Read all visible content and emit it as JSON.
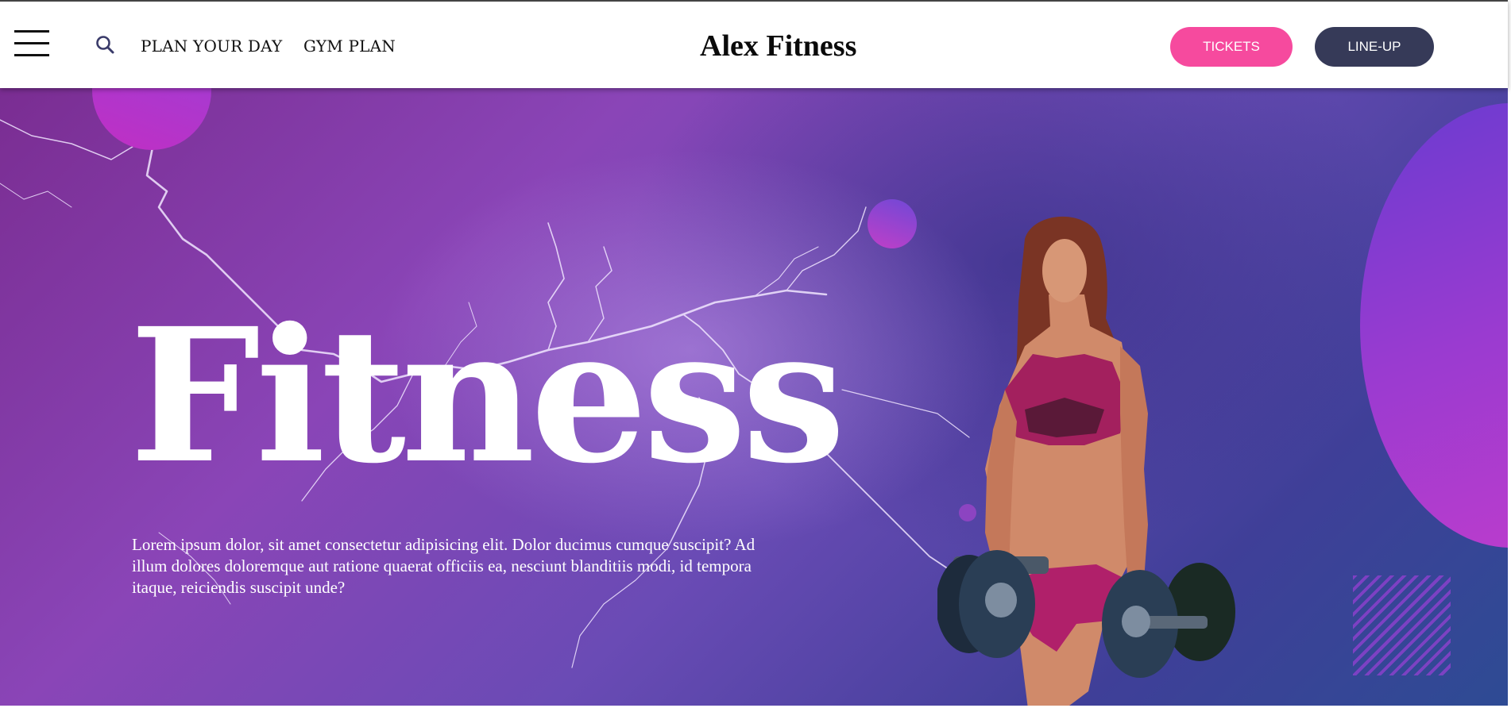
{
  "header": {
    "menu_icon": "hamburger-menu-icon",
    "search_icon": "search-icon",
    "nav": [
      {
        "label": "PLAN YOUR DAY"
      },
      {
        "label": "GYM PLAN"
      }
    ],
    "brand": "Alex Fitness",
    "buttons": {
      "tickets": {
        "label": "TICKETS",
        "color": "#f64a9e"
      },
      "lineup": {
        "label": "LINE-UP",
        "color": "#363a58"
      }
    }
  },
  "hero": {
    "title": "Fitness",
    "text": "Lorem ipsum dolor, sit amet consectetur adipisicing elit. Dolor ducimus cumque suscipit? Ad illum dolores doloremque aut ratione quaerat officiis ea, nesciunt blanditiis modi, id tempora itaque, reiciendis suscipit unde?",
    "colors": {
      "accent_purple": "#9b3fd6",
      "accent_magenta": "#c03ccc",
      "deep_blue": "#2e4b94"
    },
    "image": "woman-with-dumbbells-image"
  }
}
